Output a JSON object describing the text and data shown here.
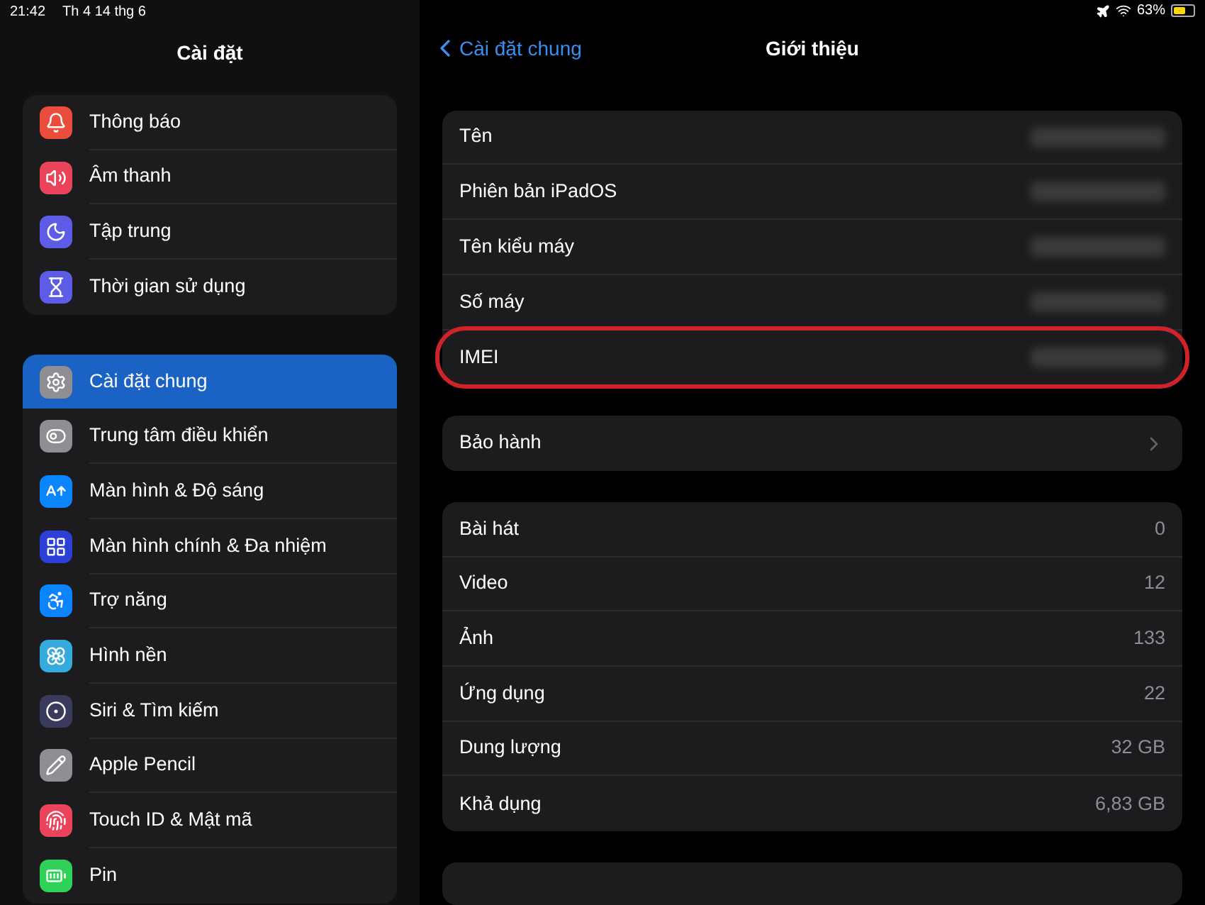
{
  "status_bar": {
    "time": "21:42",
    "date": "Th 4 14 thg 6",
    "battery": "63%"
  },
  "sidebar": {
    "title": "Cài đặt",
    "groups": [
      {
        "items": [
          {
            "label": "Thông báo",
            "color": "#eb4d3d",
            "selected": false
          },
          {
            "label": "Âm thanh",
            "color": "#eb445a",
            "selected": false
          },
          {
            "label": "Tập trung",
            "color": "#5e5ce6",
            "selected": false
          },
          {
            "label": "Thời gian sử dụng",
            "color": "#5e5ce6",
            "selected": false
          }
        ]
      },
      {
        "items": [
          {
            "label": "Cài đặt chung",
            "color": "#8e8e93",
            "selected": true
          },
          {
            "label": "Trung tâm điều khiển",
            "color": "#8e8e93",
            "selected": false
          },
          {
            "label": "Màn hình & Độ sáng",
            "color": "#0a84ff",
            "selected": false
          },
          {
            "label": "Màn hình chính & Đa nhiệm",
            "color": "#2c3fd6",
            "selected": false
          },
          {
            "label": "Trợ năng",
            "color": "#0a84ff",
            "selected": false
          },
          {
            "label": "Hình nền",
            "color": "#35aadc",
            "selected": false
          },
          {
            "label": "Siri & Tìm kiếm",
            "color": "#3a3a5c",
            "selected": false
          },
          {
            "label": "Apple Pencil",
            "color": "#8e8e93",
            "selected": false
          },
          {
            "label": "Touch ID & Mật mã",
            "color": "#eb445a",
            "selected": false
          },
          {
            "label": "Pin",
            "color": "#30d158",
            "selected": false
          }
        ]
      }
    ]
  },
  "detail": {
    "back": "Cài đặt chung",
    "title": "Giới thiệu",
    "groups": [
      {
        "rows": [
          {
            "label": "Tên",
            "kind": "redacted",
            "highlighted": false
          },
          {
            "label": "Phiên bản iPadOS",
            "kind": "redacted",
            "highlighted": false
          },
          {
            "label": "Tên kiểu máy",
            "kind": "redacted",
            "highlighted": false
          },
          {
            "label": "Số máy",
            "kind": "redacted",
            "highlighted": false
          },
          {
            "label": "IMEI",
            "kind": "redacted",
            "highlighted": true
          }
        ]
      },
      {
        "rows": [
          {
            "label": "Bảo hành",
            "kind": "link"
          }
        ]
      },
      {
        "rows": [
          {
            "label": "Bài hát",
            "kind": "value",
            "value": "0"
          },
          {
            "label": "Video",
            "kind": "value",
            "value": "12"
          },
          {
            "label": "Ảnh",
            "kind": "value",
            "value": "133"
          },
          {
            "label": "Ứng dụng",
            "kind": "value",
            "value": "22"
          },
          {
            "label": "Dung lượng",
            "kind": "value",
            "value": "32 GB"
          },
          {
            "label": "Khả dụng",
            "kind": "value",
            "value": "6,83 GB"
          }
        ]
      }
    ]
  }
}
